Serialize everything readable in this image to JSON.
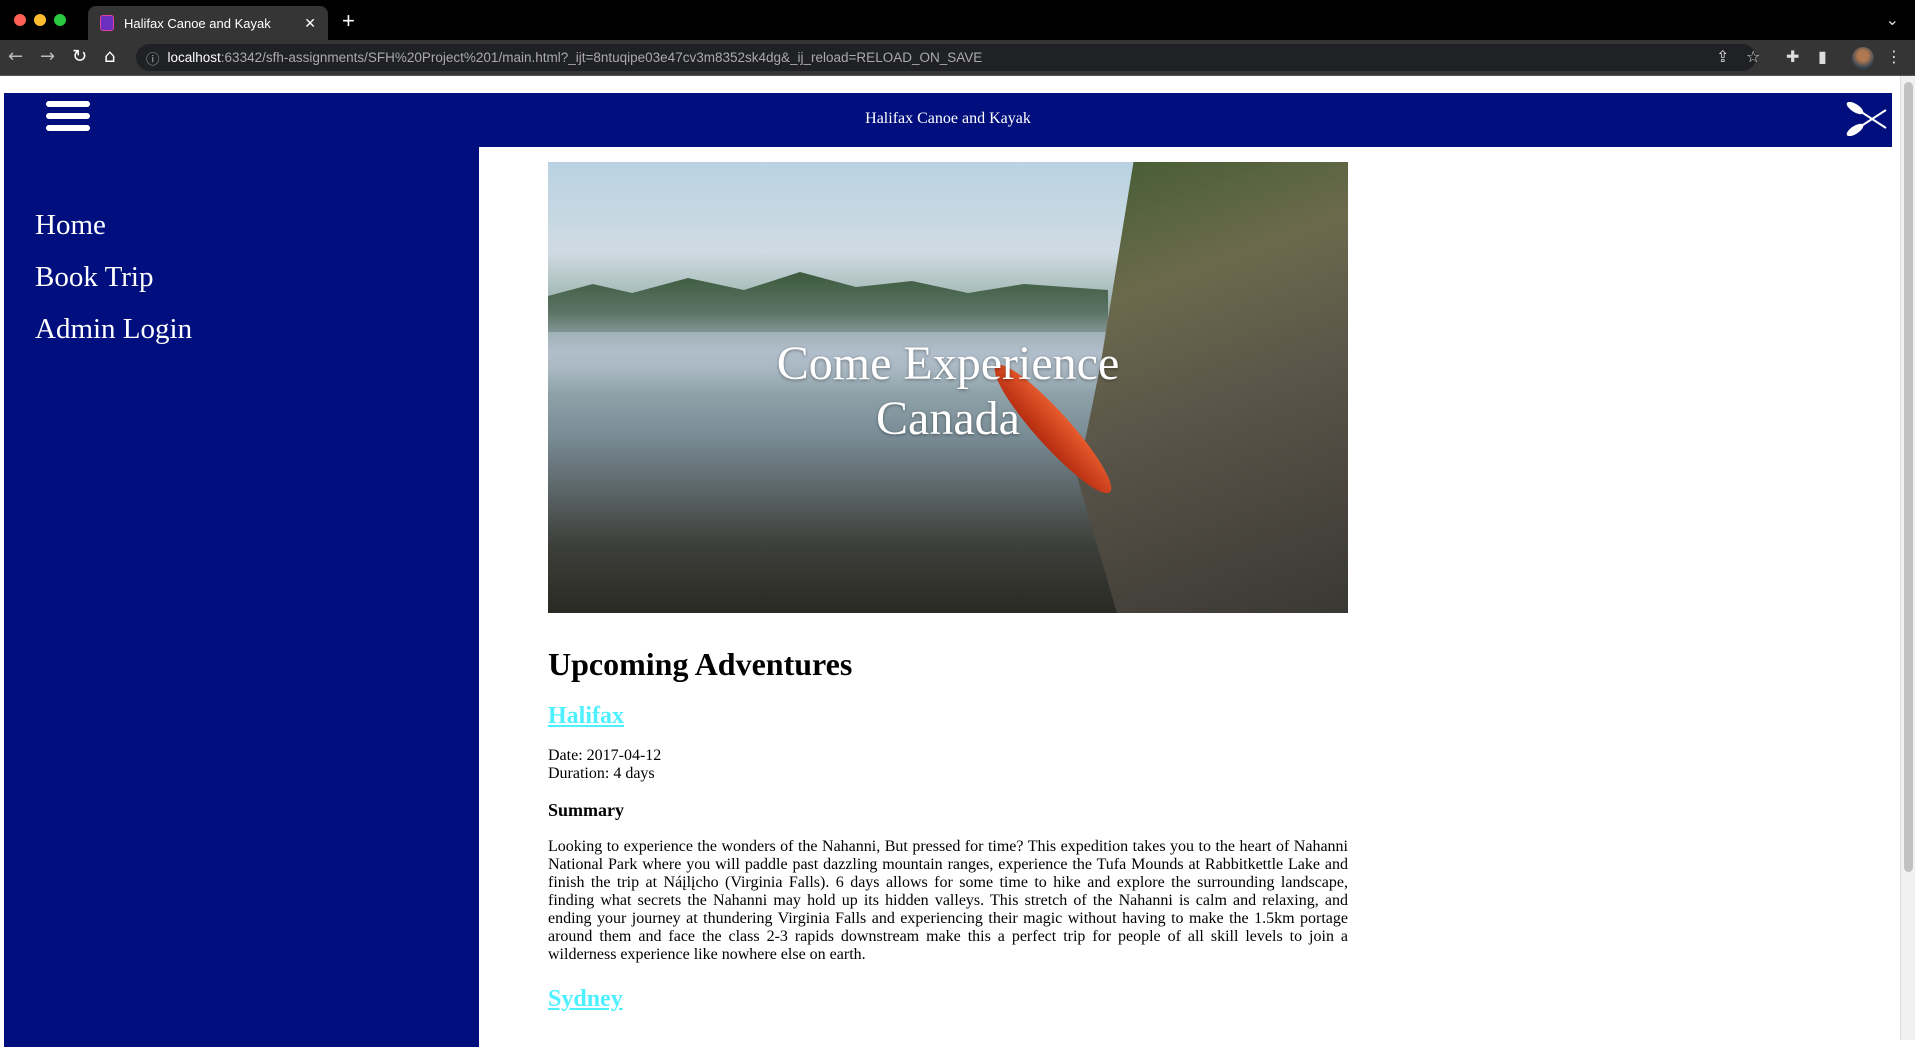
{
  "browser": {
    "tab_title": "Halifax Canoe and Kayak",
    "url_host": "localhost",
    "url_rest": ":63342/sfh-assignments/SFH%20Project%201/main.html?_ijt=8ntuqipe03e47cv3m8352sk4dg&_ij_reload=RELOAD_ON_SAVE"
  },
  "header": {
    "title": "Halifax Canoe and Kayak"
  },
  "sidebar": {
    "items": [
      {
        "label": "Home"
      },
      {
        "label": "Book Trip"
      },
      {
        "label": "Admin Login"
      }
    ]
  },
  "hero": {
    "line1": "Come Experience",
    "line2": "Canada"
  },
  "main": {
    "heading": "Upcoming Adventures",
    "trips": [
      {
        "name": "Halifax",
        "date": "Date: 2017-04-12",
        "duration": "Duration: 4 days",
        "summary_heading": "Summary",
        "summary": "Looking to experience the wonders of the Nahanni, But pressed for time? This expedition takes you to the heart of Nahanni National Park where you will paddle past dazzling mountain ranges, experience the Tufa Mounds at Rabbitkettle Lake and finish the trip at Náįlįcho (Virginia Falls). 6 days allows for some time to hike and explore the surrounding landscape, finding what secrets the Nahanni may hold up its hidden valleys. This stretch of the Nahanni is calm and relaxing, and ending your journey at thundering Virginia Falls and experiencing their magic without having to make the 1.5km portage around them and face the class 2-3 rapids downstream make this a perfect trip for people of all skill levels to join a wilderness experience like nowhere else on earth."
      },
      {
        "name": "Sydney"
      }
    ]
  },
  "colors": {
    "brand": "#000f7d",
    "link": "#4df0ff"
  }
}
